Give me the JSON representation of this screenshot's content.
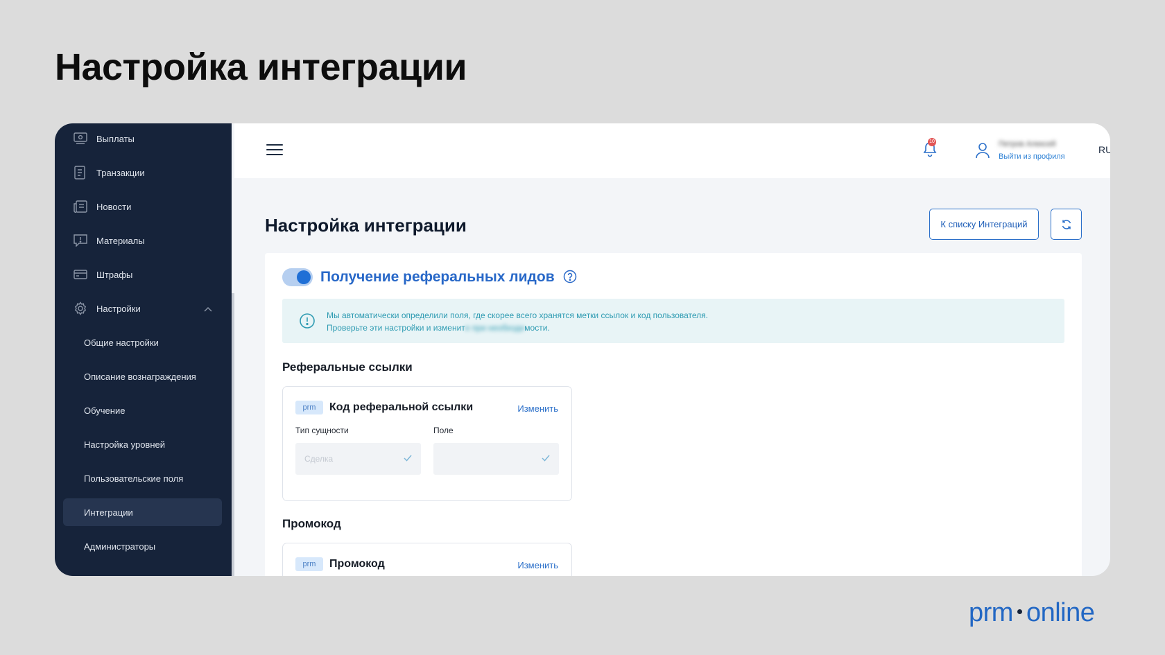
{
  "slide": {
    "title": "Настройка интеграции"
  },
  "sidebar": {
    "items": [
      {
        "label": "Выплаты",
        "icon": "payout-icon"
      },
      {
        "label": "Транзакции",
        "icon": "transactions-icon"
      },
      {
        "label": "Новости",
        "icon": "news-icon"
      },
      {
        "label": "Материалы",
        "icon": "materials-icon"
      },
      {
        "label": "Штрафы",
        "icon": "fines-icon"
      },
      {
        "label": "Настройки",
        "icon": "gear-icon"
      }
    ],
    "sub_items": [
      {
        "label": "Общие настройки"
      },
      {
        "label": "Описание вознаграждения"
      },
      {
        "label": "Обучение"
      },
      {
        "label": "Настройка уровней"
      },
      {
        "label": "Пользовательские поля"
      },
      {
        "label": "Интеграции"
      },
      {
        "label": "Администраторы"
      }
    ],
    "active_item": "Интеграции"
  },
  "header": {
    "notifications_count": "10",
    "user_name": "Петров Алексей",
    "logout_label": "Выйти из профиля",
    "language": "RU"
  },
  "main": {
    "title": "Настройка интеграции",
    "back_button": "К списку Интеграций",
    "toggle_label": "Получение реферальных лидов",
    "toggle_on": true,
    "notice": {
      "line1": "Мы автоматически определили поля, где скорее всего хранятся метки ссылок и код пользователя.",
      "line2_start": "Проверьте эти настройки и изменит",
      "line2_blurred": "е при необходи",
      "line2_end": "мости."
    },
    "sections": [
      {
        "heading": "Реферальные ссылки",
        "card": {
          "tag": "prm",
          "title": "Код реферальной ссылки",
          "edit_label": "Изменить",
          "entity_label": "Тип сущности",
          "entity_value": "Сделка",
          "field_label": "Поле",
          "field_value": ""
        }
      },
      {
        "heading": "Промокод",
        "card": {
          "tag": "prm",
          "title": "Промокод",
          "edit_label": "Изменить"
        }
      }
    ]
  },
  "brand": {
    "left": "prm",
    "right": "online"
  },
  "colors": {
    "sidebar_bg": "#16233a",
    "accent": "#2868c8",
    "notice_bg": "#e8f4f6",
    "page_bg": "#dcdcdc"
  }
}
